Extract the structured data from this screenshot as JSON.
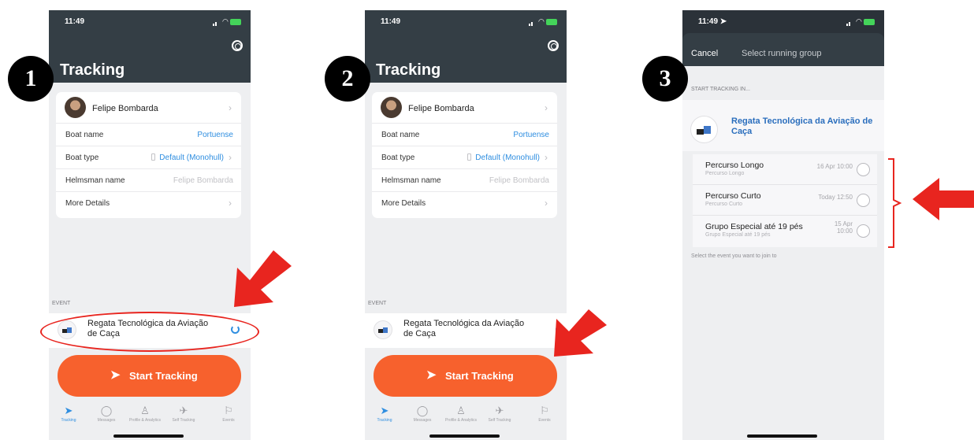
{
  "steps": [
    "1",
    "2",
    "3"
  ],
  "status_time": "11:49",
  "status_time_3": "11:49 ➤",
  "tracking": {
    "title": "Tracking",
    "user_name": "Felipe Bombarda",
    "rows": {
      "boat_name_label": "Boat name",
      "boat_name_value": "Portuense",
      "boat_type_label": "Boat type",
      "boat_type_value": "Default (Monohull)",
      "helmsman_label": "Helmsman name",
      "helmsman_value": "Felipe Bombarda",
      "more_label": "More Details"
    },
    "event_header": "EVENT",
    "event_name": "Regata Tecnológica da Aviação de Caça",
    "start_button": "Start Tracking"
  },
  "tabs": [
    {
      "label": "Tracking",
      "icon": "navigation-arrow-icon"
    },
    {
      "label": "Messages",
      "icon": "chat-bubble-icon"
    },
    {
      "label": "Profile & Analytics",
      "icon": "person-icon"
    },
    {
      "label": "Self Tracking",
      "icon": "plane-icon"
    },
    {
      "label": "Events",
      "icon": "flag-icon"
    }
  ],
  "select_group": {
    "cancel": "Cancel",
    "title": "Select running group",
    "section_header": "START TRACKING IN...",
    "event_name": "Regata Tecnológica da Aviação de Caça",
    "options": [
      {
        "name": "Percurso Longo",
        "sub": "Percurso Longo",
        "date": "16 Apr 10:00"
      },
      {
        "name": "Percurso Curto",
        "sub": "Percurso Curto",
        "date": "Today 12:50"
      },
      {
        "name": "Grupo Especial até 19 pés",
        "sub": "Grupo Especial até 19 pés",
        "date": "15 Apr 10:00"
      }
    ],
    "hint": "Select the event you want to join to"
  },
  "colors": {
    "header": "#343e45",
    "accent_orange": "#f7612d",
    "link_blue": "#2f8ee0",
    "annotation_red": "#e8251f"
  }
}
